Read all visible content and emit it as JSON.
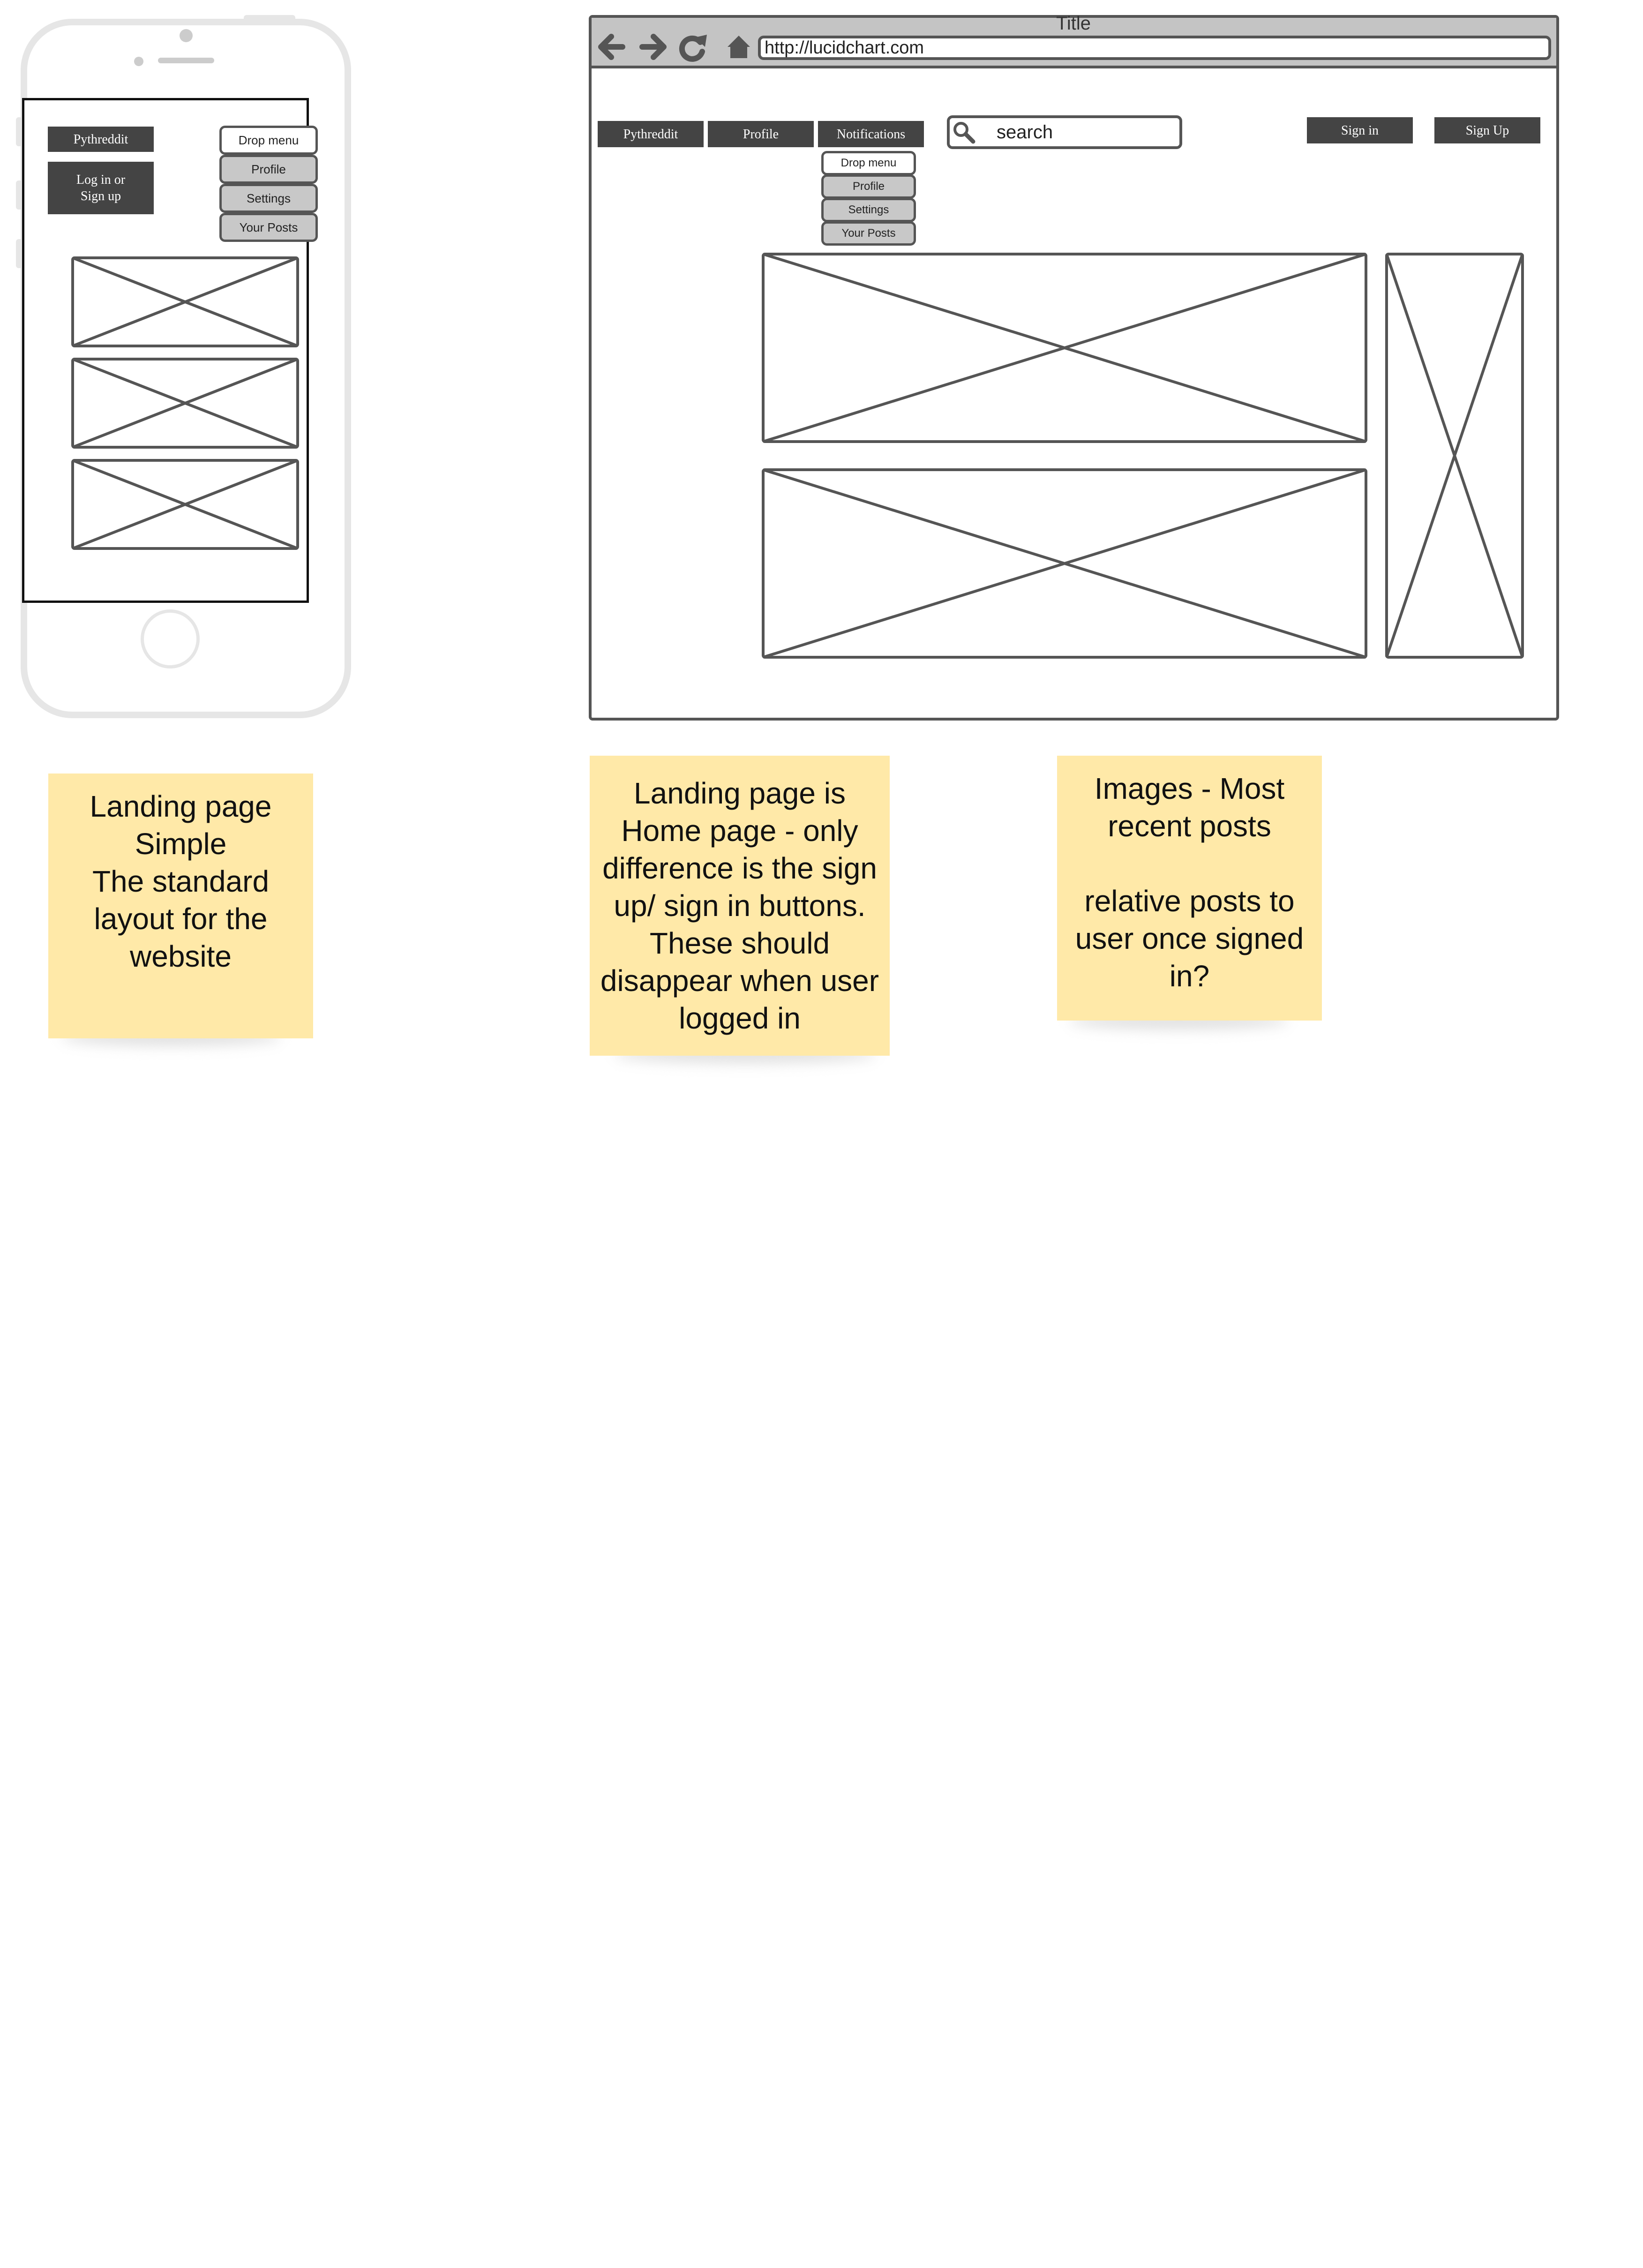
{
  "phone": {
    "logo": "Pythreddit",
    "login": "Log in or Sign up",
    "menu": [
      "Drop menu",
      "Profile",
      "Settings",
      "Your Posts"
    ]
  },
  "browser": {
    "title": "Title",
    "url": "http://lucidchart.com",
    "nav": [
      "Pythreddit",
      "Profile",
      "Notifications"
    ],
    "menu": [
      "Drop menu",
      "Profile",
      "Settings",
      "Your Posts"
    ],
    "search_placeholder": "search",
    "sign_in": "Sign in",
    "sign_up": "Sign Up"
  },
  "notes": {
    "phone_note": [
      "Landing page",
      "Simple",
      "The standard",
      "layout for the",
      "website"
    ],
    "browser_note": [
      "Landing page is",
      "Home page - only",
      "difference is the sign",
      "up/ sign in buttons.",
      "These should",
      "disappear when user",
      "logged in"
    ],
    "images_note": [
      "Images - Most",
      "recent posts",
      "",
      "relative posts to",
      "user once signed",
      "in?"
    ]
  },
  "colors": {
    "dark_button": "#444444",
    "menu_item": "#c8c8c8",
    "outline": "#555555",
    "sticky_note": "#ffe9a8",
    "phone_frame": "#e6e6e6"
  }
}
